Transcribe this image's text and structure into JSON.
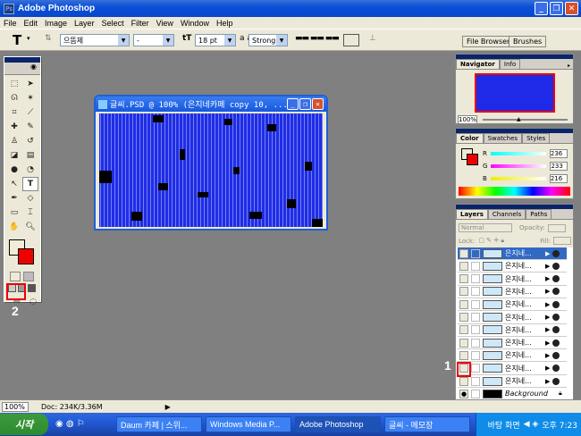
{
  "app": {
    "title": "Adobe Photoshop"
  },
  "menu": [
    "File",
    "Edit",
    "Image",
    "Layer",
    "Select",
    "Filter",
    "View",
    "Window",
    "Help"
  ],
  "options": {
    "font_family": "으뜸체",
    "font_style": "-",
    "font_size": "18 pt",
    "aa_label": "a a",
    "aa_mode": "Strong",
    "file_browser": "File Browser",
    "brushes": "Brushes"
  },
  "document": {
    "title": "글씨.PSD @ 100% (은지네카페   copy 10, ..."
  },
  "navigator": {
    "tabs": [
      "Navigator",
      "Info"
    ],
    "zoom": "100%"
  },
  "color": {
    "tabs": [
      "Color",
      "Swatches",
      "Styles"
    ],
    "r_label": "R",
    "r_value": "236",
    "g_label": "G",
    "g_value": "233",
    "b_label": "B",
    "b_value": "216"
  },
  "layers": {
    "tabs": [
      "Layers",
      "Channels",
      "Paths"
    ],
    "blend_mode": "Normal",
    "opacity_label": "Opacity:",
    "fill_label": "Fill:",
    "lock_label": "Lock:",
    "items": [
      {
        "name": "은지네..."
      },
      {
        "name": "은지네..."
      },
      {
        "name": "은지네..."
      },
      {
        "name": "은지네..."
      },
      {
        "name": "은지네..."
      },
      {
        "name": "은지네..."
      },
      {
        "name": "은지네..."
      },
      {
        "name": "은지네..."
      },
      {
        "name": "은지네..."
      },
      {
        "name": "은지네..."
      },
      {
        "name": "은지네..."
      }
    ],
    "background_name": "Background"
  },
  "annotations": {
    "label_1": "1",
    "label_2": "2"
  },
  "status": {
    "zoom": "100%",
    "doc": "Doc: 234K/3.36M"
  },
  "taskbar": {
    "start": "시작",
    "tasks": [
      "Daum 카페 | 스위...",
      "Windows Media P...",
      "Adobe Photoshop",
      "글씨 - 메모장"
    ],
    "tray_text": "바탕 화면",
    "time": "오후 7:23"
  }
}
